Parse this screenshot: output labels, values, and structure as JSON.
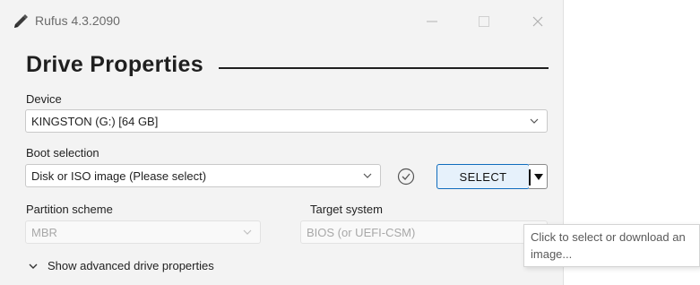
{
  "window": {
    "title": "Rufus 4.3.2090",
    "icons": {
      "app": "usb-pen-icon",
      "minimize": "minimize-icon",
      "maximize": "maximize-icon",
      "close": "close-icon"
    }
  },
  "drive_properties": {
    "heading": "Drive Properties",
    "device": {
      "label": "Device",
      "value": "KINGSTON (G:) [64 GB]"
    },
    "boot_selection": {
      "label": "Boot selection",
      "value": "Disk or ISO image (Please select)",
      "select_button": "SELECT",
      "check_icon": "check-circle-icon"
    },
    "partition_scheme": {
      "label": "Partition scheme",
      "value": "MBR"
    },
    "target_system": {
      "label": "Target system",
      "value": "BIOS (or UEFI-CSM)"
    },
    "advanced_toggle": "Show advanced drive properties"
  },
  "tooltip": {
    "text": "Click to select or download an image..."
  },
  "colors": {
    "accent": "#0f6cbd",
    "select_bg": "#e6f1fb",
    "window_bg": "#f3f3f3"
  }
}
